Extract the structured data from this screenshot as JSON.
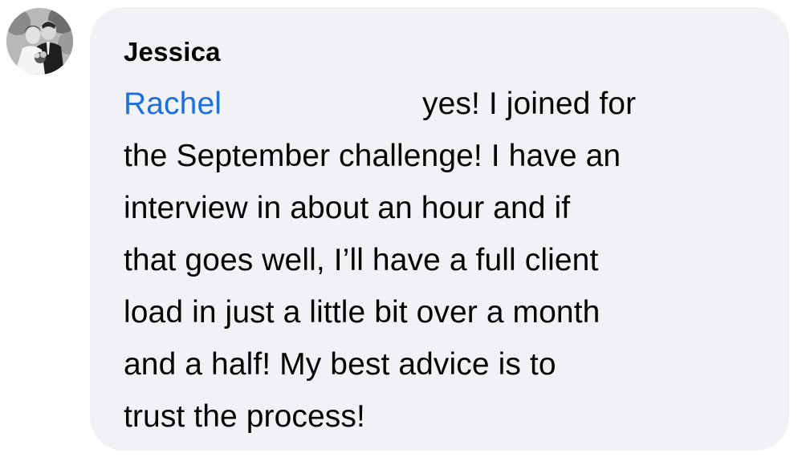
{
  "comment": {
    "author_name": "Jessica",
    "mention_name": "Rachel",
    "lines": [
      "yes! I joined for",
      "the September challenge! I have an",
      "interview in about an hour and if",
      "that goes well, I’ll have a full client",
      "load in just a little bit over a month",
      "and a half! My best advice is to",
      "trust the process!"
    ]
  },
  "colors": {
    "bubble_background": "#f0f2f5",
    "mention": "#216fdb",
    "text": "#050505"
  },
  "icons": {
    "avatar": "profile-photo"
  }
}
